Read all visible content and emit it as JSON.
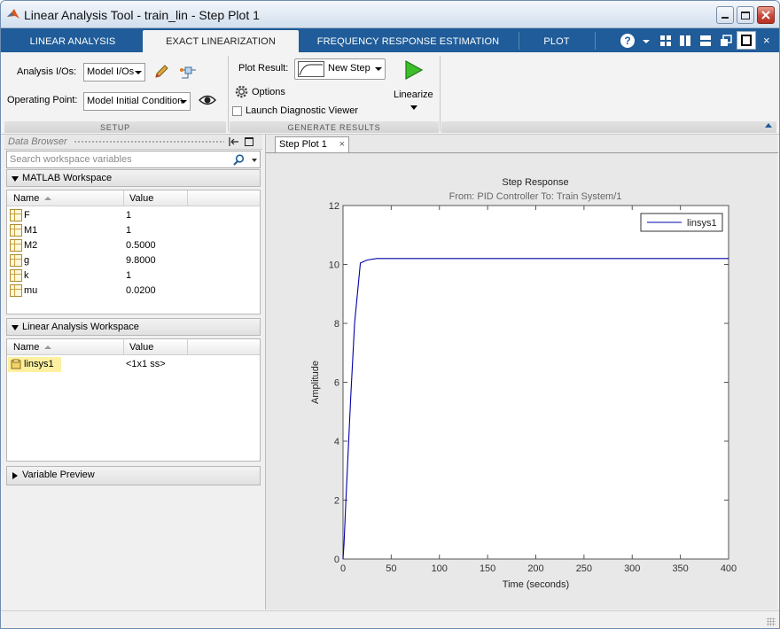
{
  "window": {
    "title": "Linear Analysis Tool - train_lin - Step Plot 1"
  },
  "tabs": [
    {
      "label": "LINEAR ANALYSIS"
    },
    {
      "label": "EXACT LINEARIZATION"
    },
    {
      "label": "FREQUENCY RESPONSE ESTIMATION"
    },
    {
      "label": "PLOT"
    }
  ],
  "toolstrip": {
    "analysis_ios_label": "Analysis I/Os:",
    "analysis_ios_value": "Model I/Os",
    "operating_point_label": "Operating Point:",
    "operating_point_value": "Model Initial Condition",
    "setup_label": "SETUP",
    "plot_result_label": "Plot Result:",
    "plot_result_value": "New Step",
    "options_label": "Options",
    "launch_diag_label": "Launch Diagnostic Viewer",
    "linearize_label": "Linearize",
    "generate_label": "GENERATE RESULTS"
  },
  "data_browser": {
    "title": "Data Browser",
    "search_placeholder": "Search workspace variables",
    "matlab_ws": {
      "title": "MATLAB Workspace",
      "col_name": "Name",
      "col_value": "Value",
      "rows": [
        {
          "name": "F",
          "value": "1"
        },
        {
          "name": "M1",
          "value": "1"
        },
        {
          "name": "M2",
          "value": "0.5000"
        },
        {
          "name": "g",
          "value": "9.8000"
        },
        {
          "name": "k",
          "value": "1"
        },
        {
          "name": "mu",
          "value": "0.0200"
        }
      ]
    },
    "linear_ws": {
      "title": "Linear Analysis Workspace",
      "col_name": "Name",
      "col_value": "Value",
      "rows": [
        {
          "name": "linsys1",
          "value": "<1x1 ss>"
        }
      ]
    },
    "variable_preview": "Variable Preview"
  },
  "plot_tab": {
    "label": "Step Plot 1",
    "close": "×"
  },
  "chart_data": {
    "type": "line",
    "title": "Step Response",
    "subtitle": "From: PID Controller  To: Train System/1",
    "xlabel": "Time (seconds)",
    "ylabel": "Amplitude",
    "xlim": [
      0,
      400
    ],
    "ylim": [
      0,
      12
    ],
    "xticks": [
      0,
      50,
      100,
      150,
      200,
      250,
      300,
      350,
      400
    ],
    "yticks": [
      0,
      2,
      4,
      6,
      8,
      10,
      12
    ],
    "grid": false,
    "legend_position": "top-right",
    "series": [
      {
        "name": "linsys1",
        "color": "#0000a8",
        "x": [
          0,
          1,
          3,
          8,
          12,
          18,
          25,
          35,
          50,
          100,
          200,
          300,
          400
        ],
        "y": [
          0,
          0.5,
          2.0,
          5.5,
          8.0,
          10.05,
          10.15,
          10.2,
          10.2,
          10.2,
          10.2,
          10.2,
          10.2
        ]
      }
    ]
  },
  "colors": {
    "tabstrip": "#1f5c99",
    "accent": "#1f5c99",
    "line": "#0000a8",
    "highlight": "#fdf0a0"
  }
}
